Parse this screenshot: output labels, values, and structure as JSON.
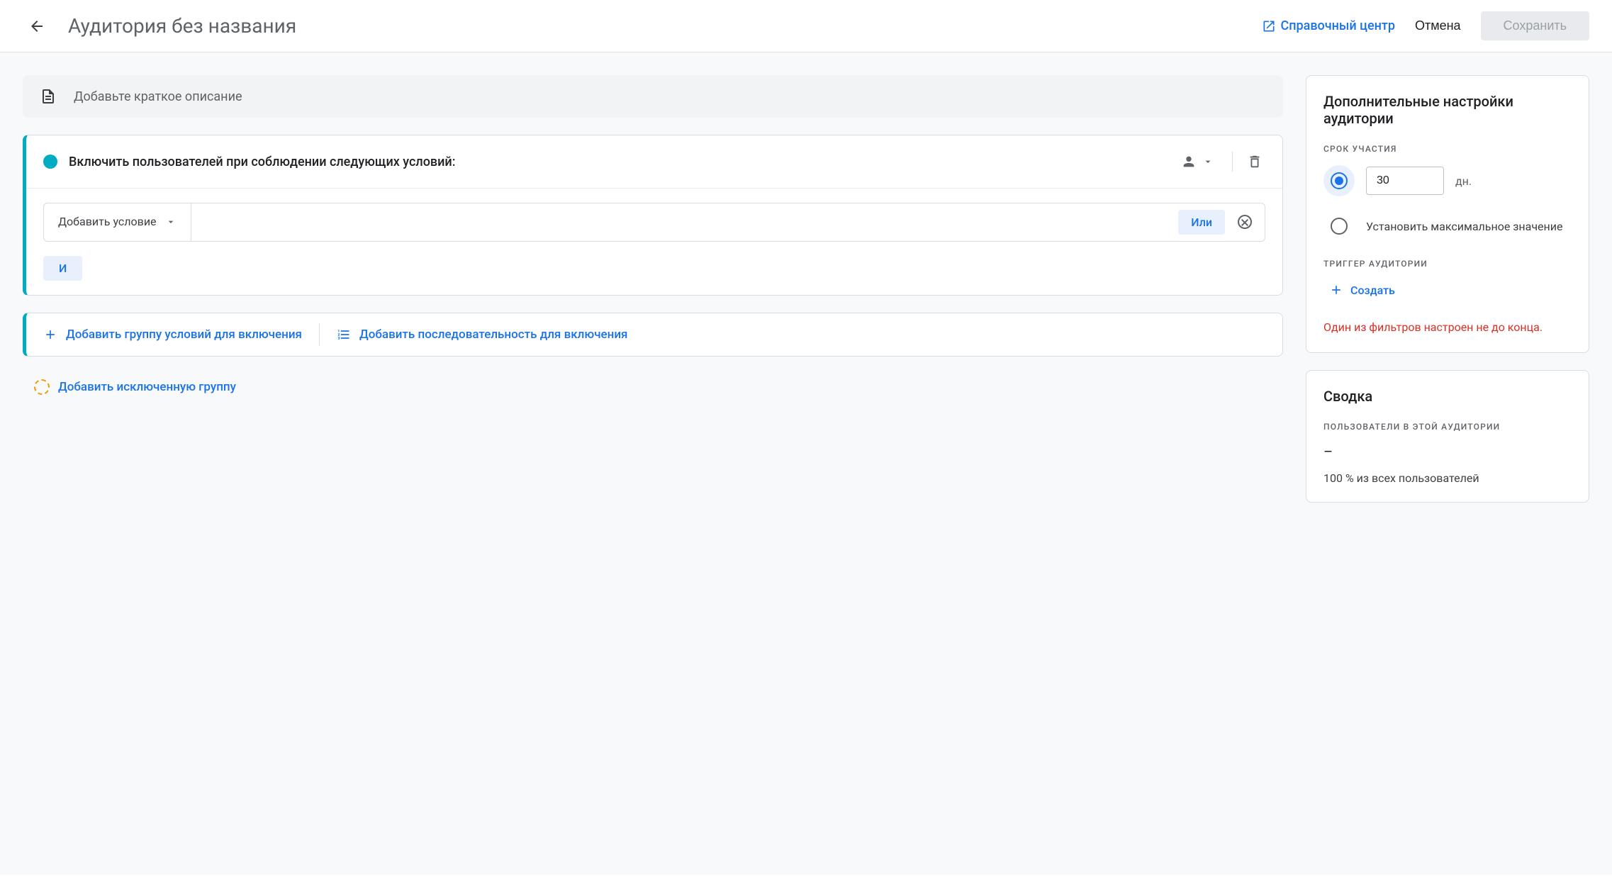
{
  "header": {
    "title": "Аудитория без названия",
    "help_label": "Справочный центр",
    "cancel_label": "Отмена",
    "save_label": "Сохранить"
  },
  "description": {
    "placeholder": "Добавьте краткое описание"
  },
  "include": {
    "title": "Включить пользователей при соблюдении следующих условий:",
    "add_condition_label": "Добавить условие",
    "or_label": "Или",
    "and_label": "И"
  },
  "add_actions": {
    "add_group_label": "Добавить группу условий для включения",
    "add_sequence_label": "Добавить последовательность для включения"
  },
  "exclude": {
    "label": "Добавить исключенную группу"
  },
  "settings": {
    "title": "Дополнительные настройки аудитории",
    "membership_section": "СРОК УЧАСТИЯ",
    "duration_value": "30",
    "duration_unit": "дн.",
    "max_label": "Установить максимальное значение",
    "trigger_section": "ТРИГГЕР АУДИТОРИИ",
    "create_label": "Создать",
    "error": "Один из фильтров настроен не до конца."
  },
  "summary": {
    "title": "Сводка",
    "users_label": "ПОЛЬЗОВАТЕЛИ В ЭТОЙ АУДИТОРИИ",
    "value": "–",
    "percent": "100 % из всех пользователей"
  }
}
